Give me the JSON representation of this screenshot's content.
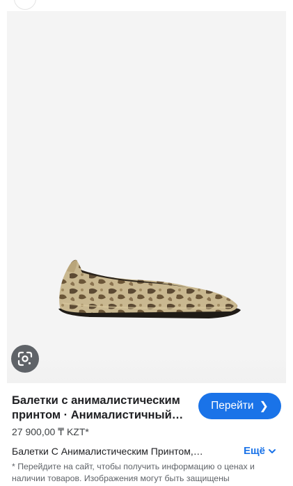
{
  "product": {
    "title": "Балетки с анималистическим принтом · Анималистичный…",
    "price": "27 900,00 ₸ KZT*",
    "store_line": "Балетки С Анималистическим Принтом,…",
    "image_alt": "snake-print ballet flat shoe"
  },
  "actions": {
    "visit_label": "Перейти",
    "more_label": "Ещё"
  },
  "disclaimer": "* Перейдите на сайт, чтобы получить информацию о ценах и наличии товаров. Изображения могут быть защищены",
  "icons": {
    "lens": "google-lens-icon",
    "visit": "chevron-right-icon",
    "more": "chevron-down-icon"
  },
  "colors": {
    "accent": "#1a73e8",
    "lens_bg": "#5f6368"
  }
}
